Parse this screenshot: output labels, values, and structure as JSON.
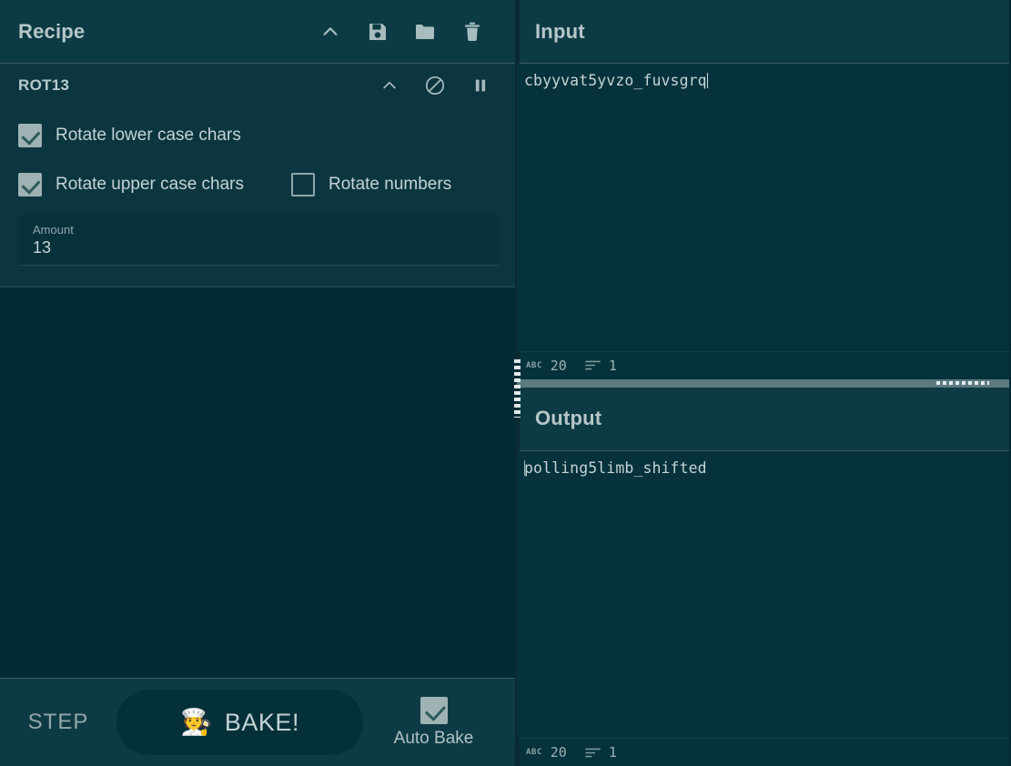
{
  "recipe": {
    "title": "Recipe",
    "title_icons": [
      {
        "name": "collapse-chevron-icon",
        "glyph": "chevron-up"
      },
      {
        "name": "save-recipe-icon",
        "glyph": "floppy"
      },
      {
        "name": "load-recipe-icon",
        "glyph": "folder"
      },
      {
        "name": "clear-recipe-icon",
        "glyph": "trash"
      }
    ],
    "operations": [
      {
        "name": "ROT13",
        "icons": [
          {
            "name": "collapse-op-chevron-icon",
            "glyph": "chevron-up"
          },
          {
            "name": "disable-op-icon",
            "glyph": "ban"
          },
          {
            "name": "breakpoint-op-icon",
            "glyph": "pause"
          }
        ],
        "checkboxes": [
          {
            "label": "Rotate lower case chars",
            "checked": true
          },
          {
            "label": "Rotate upper case chars",
            "checked": true
          },
          {
            "label": "Rotate numbers",
            "checked": false
          }
        ],
        "number_field": {
          "label": "Amount",
          "value": "13"
        }
      }
    ]
  },
  "controls": {
    "step_label": "STEP",
    "bake_label": "BAKE!",
    "bake_icon": "🧑‍🍳",
    "auto_bake_label": "Auto Bake",
    "auto_bake_checked": true
  },
  "input": {
    "title": "Input",
    "text": "cbyyvat5yvzo_fuvsgrq",
    "status": {
      "length_icon": "ABC",
      "length": "20",
      "lines_icon": "lines",
      "lines": "1"
    }
  },
  "output": {
    "title": "Output",
    "text": "polling5limb_shifted",
    "status": {
      "length_icon": "ABC",
      "length": "20",
      "lines_icon": "lines",
      "lines": "1"
    }
  },
  "colors": {
    "background": "#002b36",
    "panel_header": "#0d3b45",
    "operation_body": "#0b3640",
    "io_body": "#05323c",
    "text_primary": "#c4d3d4",
    "text_muted": "#8fa7a9",
    "splitter": "#5c7a80"
  }
}
